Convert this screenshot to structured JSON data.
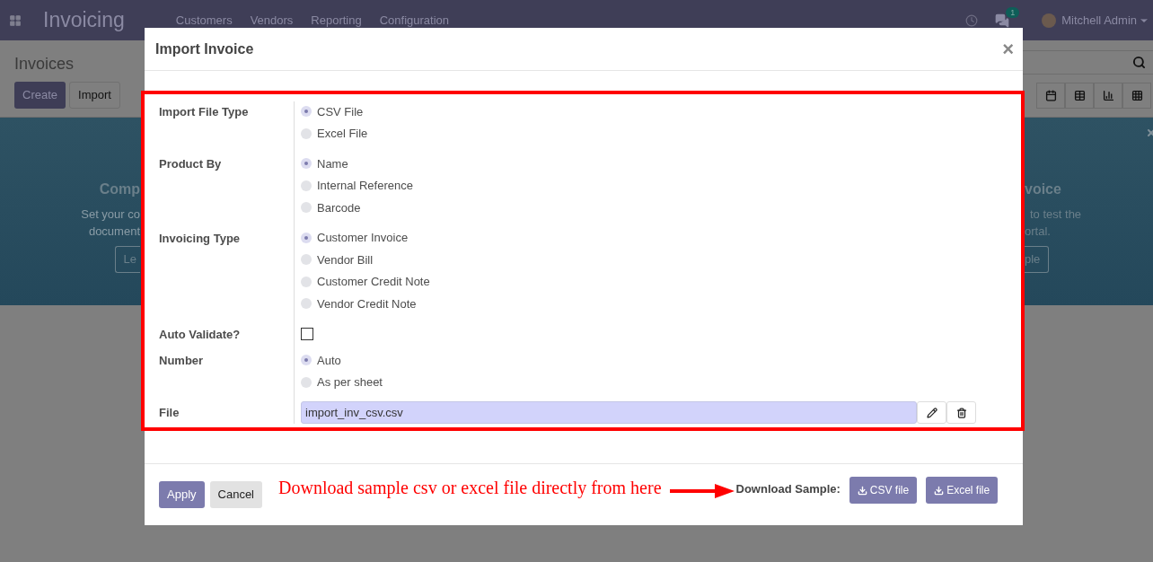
{
  "navbar": {
    "app_title": "Invoicing",
    "menu": [
      "Customers",
      "Vendors",
      "Reporting",
      "Configuration"
    ],
    "message_count": "1",
    "user": "Mitchell Admin"
  },
  "control_panel": {
    "title": "Invoices",
    "buttons": [
      {
        "label": "Create",
        "kind": "primary"
      },
      {
        "label": "Import",
        "kind": "secondary"
      }
    ]
  },
  "banner": {
    "left": {
      "title": "Comp",
      "lines": [
        "Set your co",
        "document"
      ],
      "button": "Le"
    },
    "right": {
      "title": "voice",
      "lines": [
        "to test the",
        "ortal."
      ],
      "button": "ple"
    }
  },
  "dialog": {
    "title": "Import Invoice",
    "close": "×",
    "fields": [
      {
        "label": "Import File Type",
        "kind": "radio",
        "options": [
          {
            "label": "CSV File",
            "selected": true
          },
          {
            "label": "Excel File",
            "selected": false
          }
        ]
      },
      {
        "label": "Product By",
        "kind": "radio",
        "options": [
          {
            "label": "Name",
            "selected": true
          },
          {
            "label": "Internal Reference",
            "selected": false
          },
          {
            "label": "Barcode",
            "selected": false
          }
        ]
      },
      {
        "label": "Invoicing Type",
        "kind": "radio",
        "options": [
          {
            "label": "Customer Invoice",
            "selected": true
          },
          {
            "label": "Vendor Bill",
            "selected": false
          },
          {
            "label": "Customer Credit Note",
            "selected": false
          },
          {
            "label": "Vendor Credit Note",
            "selected": false
          }
        ]
      },
      {
        "label": "Auto Validate?",
        "kind": "checkbox",
        "checked": false
      },
      {
        "label": "Number",
        "kind": "radio",
        "options": [
          {
            "label": "Auto",
            "selected": true
          },
          {
            "label": "As per sheet",
            "selected": false
          }
        ]
      },
      {
        "label": "File",
        "kind": "file",
        "value": "import_inv_csv.csv"
      }
    ],
    "footer": {
      "buttons": [
        {
          "label": "Apply",
          "kind": "primary"
        },
        {
          "label": "Cancel",
          "kind": "secondary"
        }
      ],
      "annotation": "Download sample csv or excel file directly from here",
      "download_label": "Download Sample:",
      "download_buttons": [
        "CSV file",
        "Excel file"
      ]
    }
  }
}
